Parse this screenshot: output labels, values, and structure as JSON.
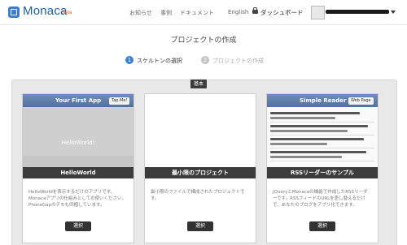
{
  "header": {
    "logo_text": "Monaca",
    "beta_label": "Beta",
    "nav": [
      "お知らせ",
      "事例",
      "ドキュメント",
      "English"
    ],
    "dashboard_label": "ダッシュボード"
  },
  "page": {
    "title": "プロジェクトの作成",
    "steps": [
      {
        "number": "1",
        "label": "スケルトンの選択",
        "active": true
      },
      {
        "number": "2",
        "label": "プロジェクトの作成",
        "active": false
      }
    ],
    "section_tag": "基本"
  },
  "cards": [
    {
      "header_title": "Your First App",
      "header_button": "Tap Me!",
      "preview_text": "HelloWorld!",
      "name": "HelloWorld",
      "platforms": "  ",
      "description": "HelloWorldを表示するだけのアプリです。Monacaアプリの仕組みとしてお使いください。PhoneGapのデモも同梱しています。",
      "button": "選択"
    },
    {
      "name": "最小限のプロジェクト",
      "platforms": "  ",
      "description": "最小限のファイルで構成されたプロジェクトです。",
      "button": "選択"
    },
    {
      "header_title": "Simple Reader",
      "header_button": "Web Page",
      "name": "RSSリーダーのサンプル",
      "platforms": "  ",
      "description": "JQueryとMonacaの機能で作成したRSSリーダーです。RSSフィードのURLを差し替えるだけで、あなたのブログをアプリ化できます。",
      "button": "選択"
    }
  ],
  "colors": {
    "accent": "#3b7fd0",
    "card_header": "#5f7fab",
    "dark_bar": "#3c3c3c",
    "panel_bg": "#e8e8e8"
  }
}
